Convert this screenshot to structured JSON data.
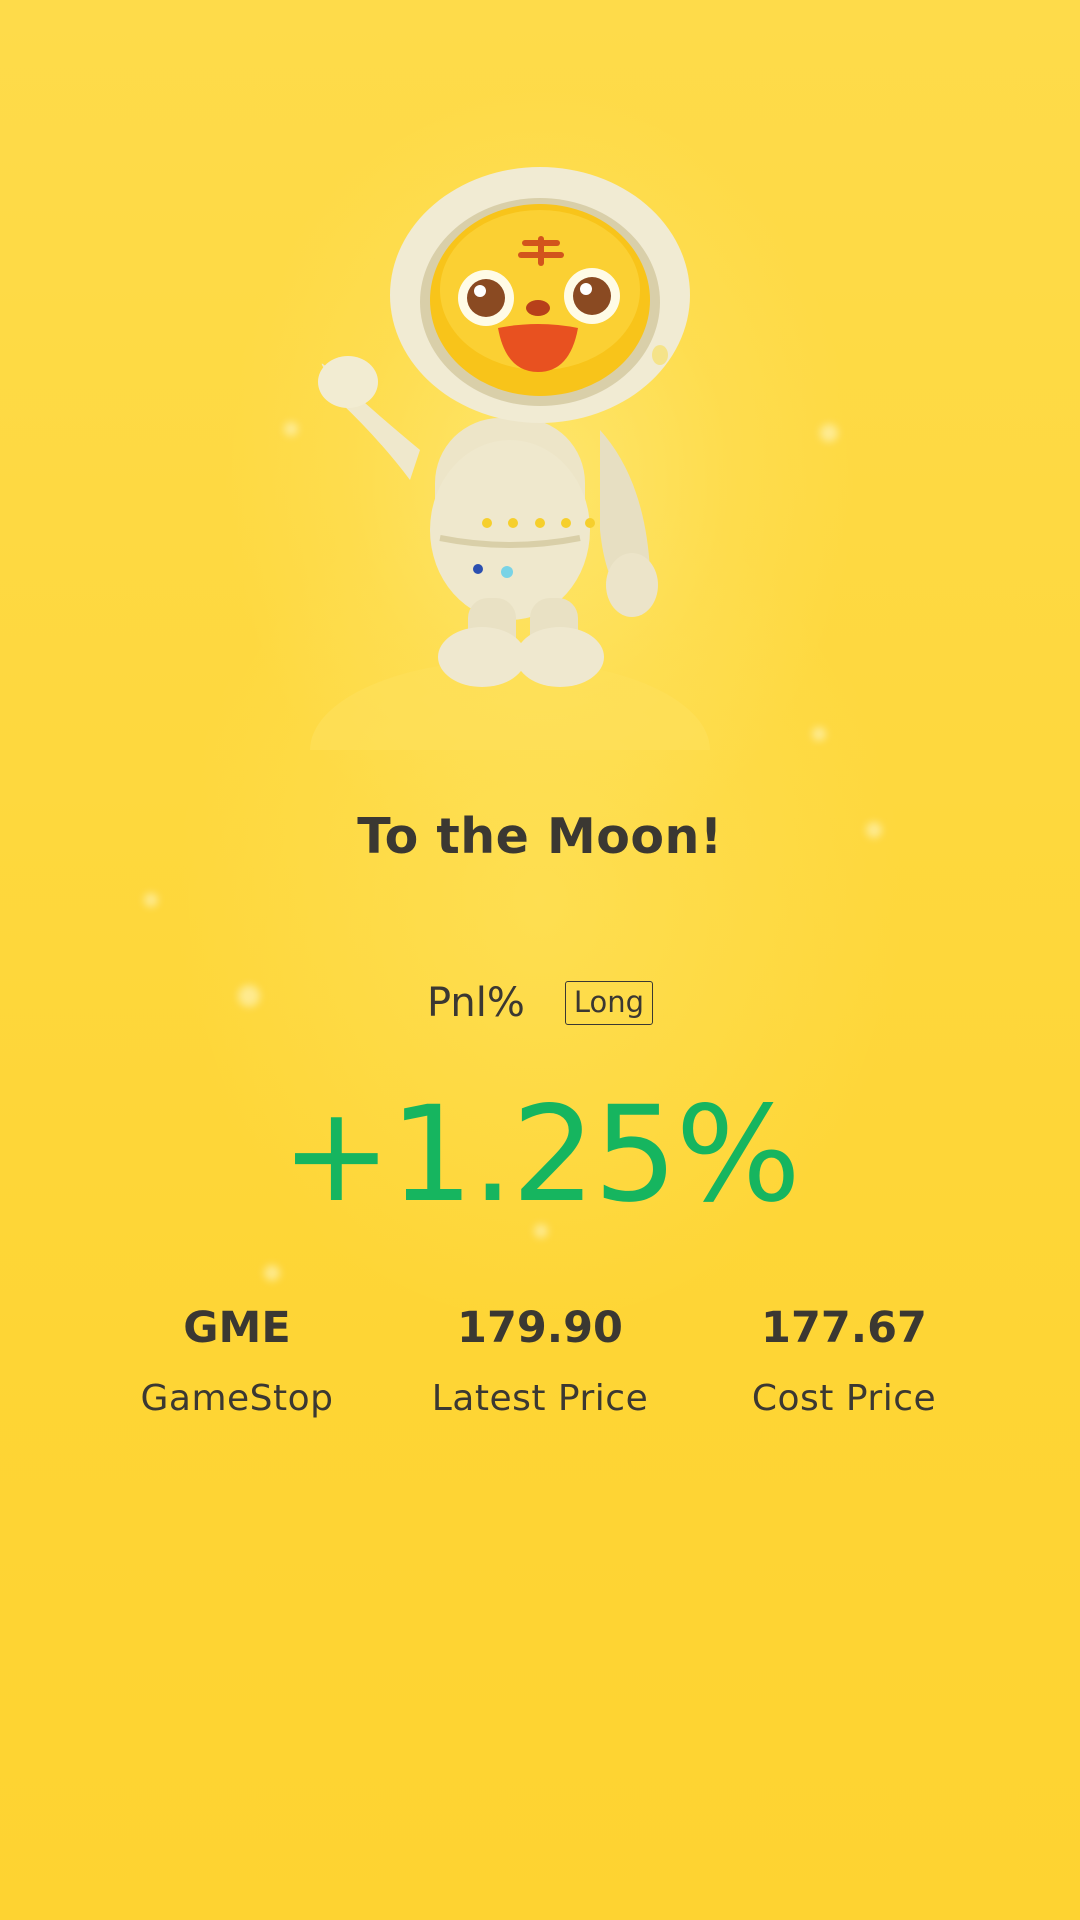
{
  "card": {
    "title": "To the Moon!",
    "mascot": "tiger-astronaut-mascot-icon"
  },
  "pnl": {
    "label": "Pnl%",
    "direction": "Long",
    "value": "+1.25%",
    "value_color": "#16b55f"
  },
  "stats": [
    {
      "value": "GME",
      "label": "GameStop"
    },
    {
      "value": "179.90",
      "label": "Latest Price"
    },
    {
      "value": "177.67",
      "label": "Cost Price"
    }
  ],
  "colors": {
    "background": "#fdd63a",
    "text": "#3b3832",
    "gain": "#16b55f"
  }
}
